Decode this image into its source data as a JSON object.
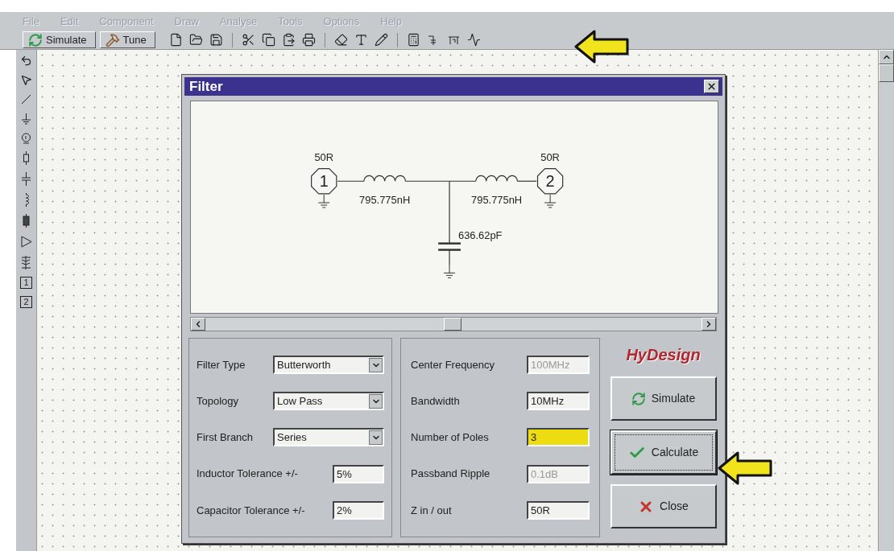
{
  "menu": [
    {
      "label": "File",
      "disabled": true
    },
    {
      "label": "Edit",
      "disabled": true
    },
    {
      "label": "Component",
      "disabled": true
    },
    {
      "label": "Draw",
      "disabled": true
    },
    {
      "label": "Analyse",
      "disabled": true
    },
    {
      "label": "Tools",
      "disabled": true
    },
    {
      "label": "Options",
      "disabled": true
    },
    {
      "label": "Help",
      "disabled": true
    }
  ],
  "toolbar": {
    "buttons": [
      {
        "label": "Simulate",
        "kind": "simulate"
      },
      {
        "label": "Tune",
        "kind": "tune"
      }
    ]
  },
  "palette": {
    "ports": [
      "1",
      "2"
    ]
  },
  "dialog": {
    "title": "Filter",
    "schematic": {
      "ports": [
        {
          "number": "1",
          "impedance": "50R"
        },
        {
          "number": "2",
          "impedance": "50R"
        }
      ],
      "components": [
        {
          "kind": "inductor",
          "value": "795.775nH"
        },
        {
          "kind": "inductor",
          "value": "795.775nH"
        },
        {
          "kind": "capacitor",
          "value": "636.62pF"
        }
      ]
    },
    "left_fields": [
      {
        "label": "Filter Type",
        "value": "Butterworth",
        "kind": "dropdown"
      },
      {
        "label": "Topology",
        "value": "Low Pass",
        "kind": "dropdown"
      },
      {
        "label": "First Branch",
        "value": "Series",
        "kind": "dropdown"
      },
      {
        "label": "Inductor Tolerance +/-",
        "value": "5%",
        "kind": "text"
      },
      {
        "label": "Capacitor Tolerance +/-",
        "value": "2%",
        "kind": "text"
      }
    ],
    "right_fields": [
      {
        "label": "Center Frequency",
        "value": "100MHz",
        "disabled": true,
        "highlighted": false
      },
      {
        "label": "Bandwidth",
        "value": "10MHz",
        "disabled": false,
        "highlighted": false
      },
      {
        "label": "Number of Poles",
        "value": "3",
        "disabled": false,
        "highlighted": true
      },
      {
        "label": "Passband Ripple",
        "value": "0.1dB",
        "disabled": true,
        "highlighted": false
      },
      {
        "label": "Z in / out",
        "value": "50R",
        "disabled": false,
        "highlighted": false
      }
    ],
    "logo": "HyDesign",
    "buttons": [
      {
        "label": "Simulate",
        "kind": "simulate",
        "focused": false
      },
      {
        "label": "Calculate",
        "kind": "calculate",
        "focused": true
      },
      {
        "label": "Close",
        "kind": "close",
        "focused": false
      }
    ]
  }
}
